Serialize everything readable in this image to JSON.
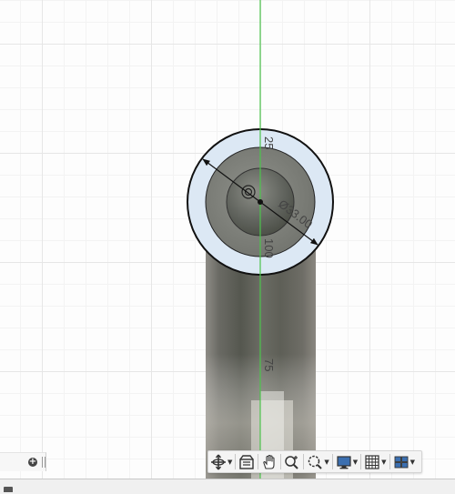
{
  "viewport": {
    "dimensions": {
      "top_radial": "25",
      "right_radial": "100",
      "diameter": "Ø33.00",
      "length": "75"
    },
    "colors": {
      "axis_line": "#4cc44c",
      "sketch_line": "#111111",
      "face_fill": "#dce8f4",
      "body_dark": "#5f625c"
    }
  },
  "left_panel": {
    "add_icon": "add-icon"
  },
  "nav_toolbar": {
    "tools": [
      {
        "name": "orbit",
        "icon": "orbit-icon",
        "has_menu": true
      },
      {
        "name": "look-at",
        "icon": "look-at-icon",
        "has_menu": false
      },
      {
        "name": "pan",
        "icon": "pan-hand-icon",
        "has_menu": false
      },
      {
        "name": "zoom",
        "icon": "zoom-icon",
        "has_menu": false
      },
      {
        "name": "fit",
        "icon": "fit-zoom-icon",
        "has_menu": true
      },
      {
        "name": "display-settings",
        "icon": "monitor-icon",
        "has_menu": true
      },
      {
        "name": "grid-settings",
        "icon": "grid-icon",
        "has_menu": true
      },
      {
        "name": "viewports",
        "icon": "viewports-icon",
        "has_menu": true
      }
    ]
  }
}
